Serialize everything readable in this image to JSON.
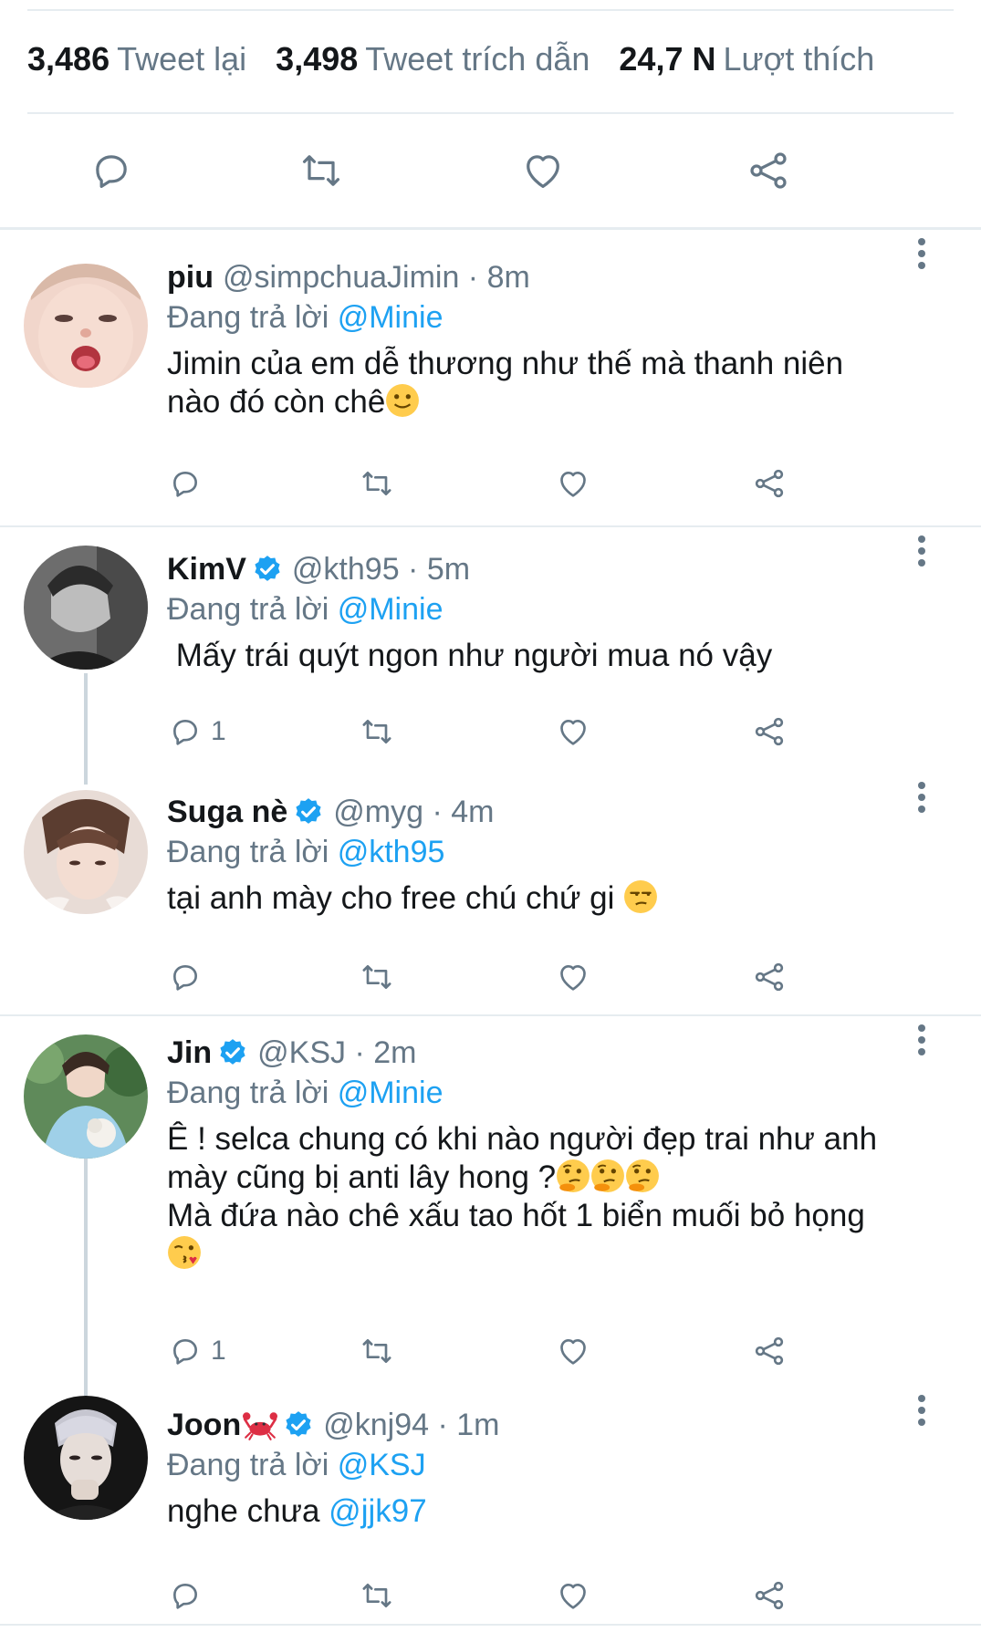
{
  "stats": [
    {
      "number": "3,486",
      "label": "Tweet lại"
    },
    {
      "number": "3,498",
      "label": "Tweet trích dẫn"
    },
    {
      "number": "24,7 N",
      "label": "Lượt thích"
    }
  ],
  "main_actions": [
    "reply-icon",
    "retweet-icon",
    "like-icon",
    "share-icon"
  ],
  "replying_prefix": "Đang trả lời",
  "tweets": [
    {
      "name": "piu",
      "verified": false,
      "handle": "@simpchuaJimin · 8m",
      "replying_to": "@Minie",
      "text_lines": [
        "Jimin của em dễ thương như thế mà thanh niên",
        "nào đó còn chê"
      ],
      "emojis": [
        "slightly-smiling-face"
      ],
      "reply_count": ""
    },
    {
      "name": "KimV",
      "verified": true,
      "handle": "@kth95 · 5m",
      "replying_to": "@Minie",
      "text_lines": [
        " Mấy trái quýt ngon như người mua nó vậy"
      ],
      "emojis": [],
      "reply_count": "1"
    },
    {
      "name": "Suga nè",
      "verified": true,
      "handle": "@myg · 4m",
      "replying_to": "@kth95",
      "text_lines": [
        "tại anh mày cho free chú chứ gi "
      ],
      "emojis": [
        "unamused-face"
      ],
      "reply_count": ""
    },
    {
      "name": "Jin",
      "verified": true,
      "handle": "@KSJ · 2m",
      "replying_to": "@Minie",
      "text_lines": [
        "Ê ! selca chung có khi nào người đẹp trai như anh",
        "mày cũng bị anti lây hong ?",
        "Mà đứa nào chê xấu tao hốt 1 biển muối bỏ họng"
      ],
      "emojis": [
        "thinking-face",
        "thinking-face",
        "thinking-face",
        "kissing-face"
      ],
      "reply_count": "1"
    },
    {
      "name": "Joon",
      "verified": true,
      "handle": "@knj94 · 1m",
      "replying_to": "@KSJ",
      "text_lines": [
        "nghe chưa "
      ],
      "text_mention": "@jjk97",
      "emojis": [
        "crab"
      ],
      "reply_count": ""
    }
  ],
  "colors": {
    "accent": "#1da1f2",
    "secondary_text": "#657786",
    "divider": "#e6ecf0",
    "icon": "#657786"
  }
}
